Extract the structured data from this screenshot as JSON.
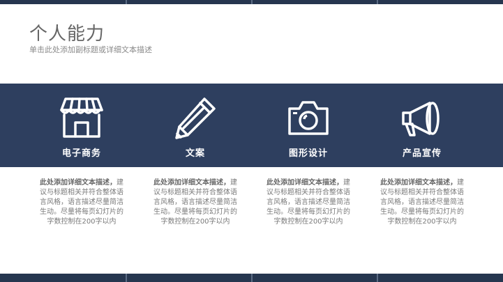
{
  "header": {
    "title": "个人能力",
    "subtitle": "单击此处添加副标题或详细文本描述"
  },
  "features": [
    {
      "label": "电子商务",
      "icon": "shop-icon",
      "desc_lead": "此处添加详细文本描述，",
      "desc_body": "建议与标题相关并符合整体语言风格，语言描述尽量简洁生动。尽量将每页幻灯片的字数控制在200字以内"
    },
    {
      "label": "文案",
      "icon": "pencil-icon",
      "desc_lead": "此处添加详细文本描述，",
      "desc_body": "建议与标题相关并符合整体语言风格，语言描述尽量简洁生动。尽量将每页幻灯片的字数控制在200字以内"
    },
    {
      "label": "图形设计",
      "icon": "camera-icon",
      "desc_lead": "此处添加详细文本描述，",
      "desc_body": "建议与标题相关并符合整体语言风格，语言描述尽量简洁生动。尽量将每页幻灯片的字数控制在200字以内"
    },
    {
      "label": "产品宣传",
      "icon": "megaphone-icon",
      "desc_lead": "此处添加详细文本描述，",
      "desc_body": "建议与标题相关并符合整体语言风格，语言描述尽量简洁生动。尽量将每页幻灯片的字数控制在200字以内"
    }
  ],
  "colors": {
    "band": "#2e3f5f",
    "edge": "#26364f",
    "title": "#666666"
  }
}
